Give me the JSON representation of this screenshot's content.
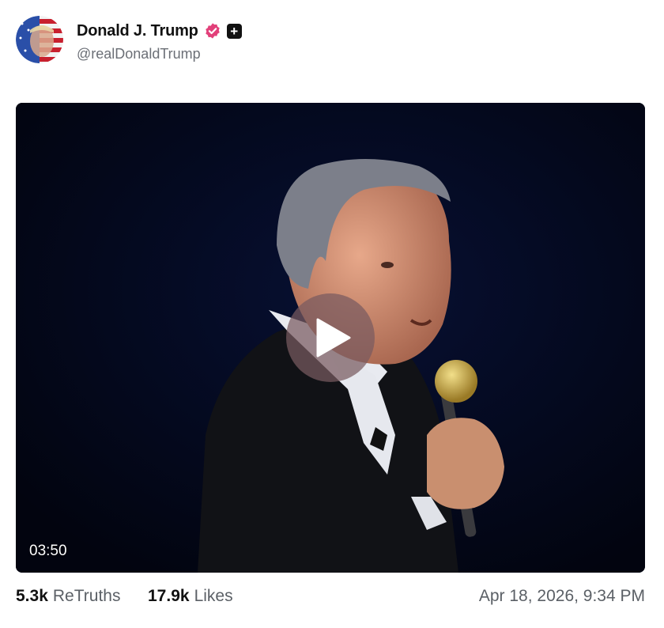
{
  "post": {
    "author": {
      "display_name": "Donald J. Trump",
      "handle": "@realDonaldTrump",
      "verified_color": "#e2407a"
    },
    "video": {
      "duration": "03:50",
      "background_color": "#030717"
    },
    "stats": {
      "retruths_count": "5.3k",
      "retruths_label": "ReTruths",
      "likes_count": "17.9k",
      "likes_label": "Likes"
    },
    "timestamp": "Apr 18, 2026, 9:34 PM"
  }
}
